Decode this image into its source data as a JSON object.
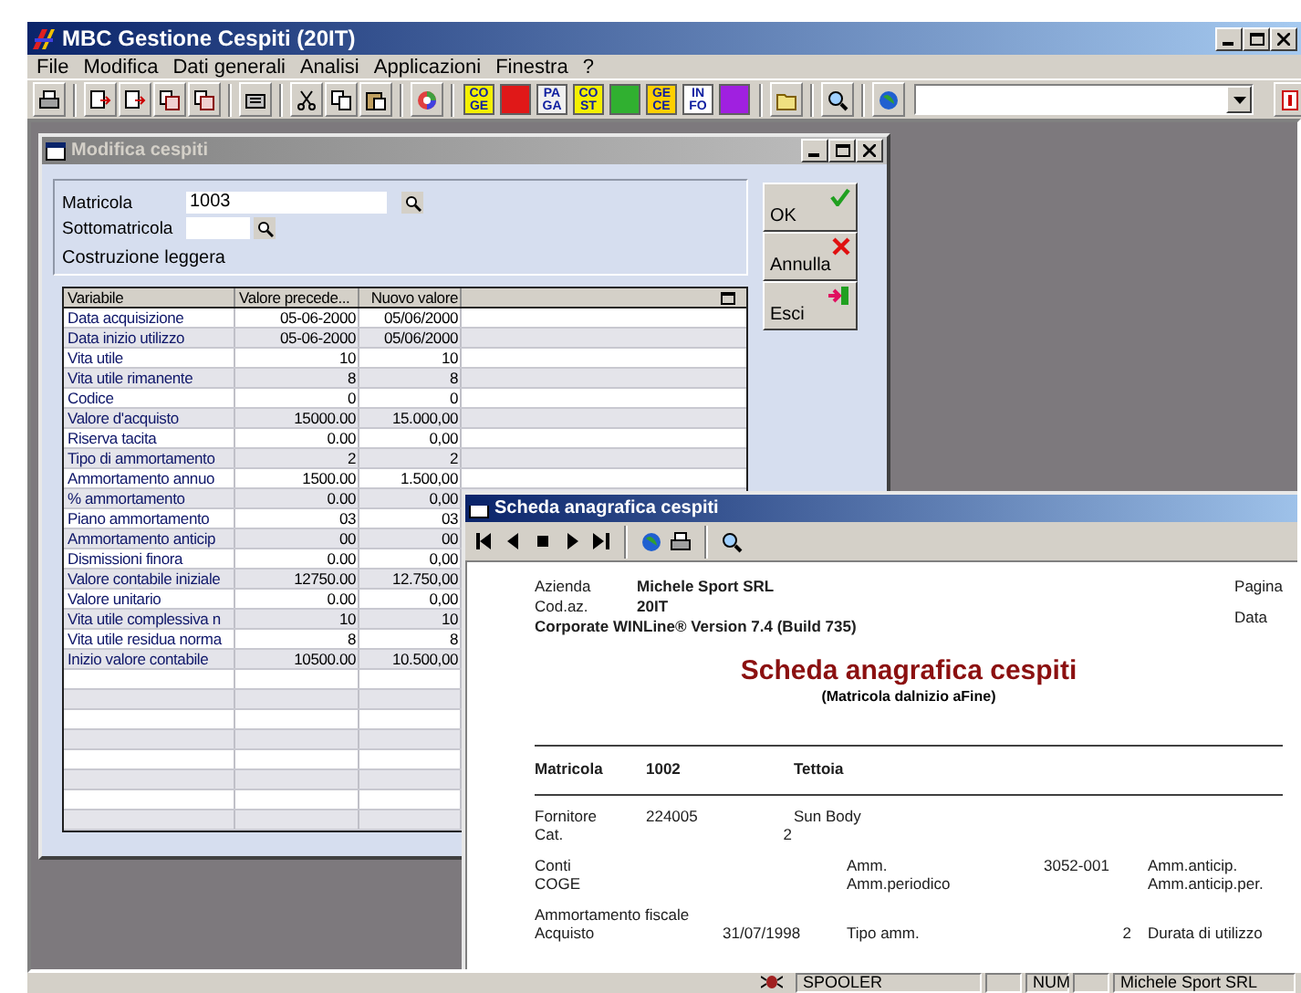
{
  "app": {
    "title": "MBC Gestione Cespiti (20IT)"
  },
  "menu": [
    "File",
    "Modifica",
    "Dati generali",
    "Analisi",
    "Applicazioni",
    "Finestra",
    "?"
  ],
  "toolbar": {
    "modules": [
      {
        "label": "CO GE",
        "color": "#f4f000",
        "kind": "text"
      },
      {
        "color": "#e01818",
        "kind": "plain"
      },
      {
        "label": "PA GA",
        "color": "#f0f0f0",
        "kind": "text"
      },
      {
        "label": "CO ST",
        "color": "#f4f000",
        "kind": "text"
      },
      {
        "color": "#30b030",
        "kind": "plain"
      },
      {
        "label": "GE CE",
        "color": "#ffd000",
        "kind": "text"
      },
      {
        "label": "IN FO",
        "color": "#ffffff",
        "kind": "text"
      },
      {
        "color": "#a020e0",
        "kind": "plain"
      }
    ]
  },
  "edit_window": {
    "title": "Modifica cespiti",
    "active": false,
    "fields": [
      {
        "label": "Matricola",
        "value": "1003",
        "kind": "wide"
      },
      {
        "label": "Sottomatricola",
        "kind": "narrow"
      }
    ],
    "description": "Costruzione leggera",
    "buttons": [
      {
        "label": "OK",
        "kind": "ok"
      },
      {
        "label": "Annulla",
        "kind": "cancel"
      },
      {
        "label": "Esci",
        "kind": "exit"
      }
    ],
    "table": {
      "columns": [
        "Variabile",
        "Valore precede...",
        "Nuovo valore"
      ],
      "rows": [
        [
          "Data acquisizione",
          "05-06-2000",
          "05/06/2000"
        ],
        [
          "Data inizio utilizzo",
          "05-06-2000",
          "05/06/2000"
        ],
        [
          "Vita utile",
          "10",
          "10"
        ],
        [
          "Vita utile rimanente",
          "8",
          "8"
        ],
        [
          "Codice",
          "0",
          "0"
        ],
        [
          "Valore d'acquisto",
          "15000.00",
          "15.000,00"
        ],
        [
          "Riserva tacita",
          "0.00",
          "0,00"
        ],
        [
          "Tipo di ammortamento",
          "2",
          "2"
        ],
        [
          "Ammortamento annuo",
          "1500.00",
          "1.500,00"
        ],
        [
          "% ammortamento",
          "0.00",
          "0,00"
        ],
        [
          "Piano ammortamento",
          "03",
          "03"
        ],
        [
          "Ammortamento anticip",
          "00",
          "00"
        ],
        [
          "Dismissioni finora",
          "0.00",
          "0,00"
        ],
        [
          "Valore contabile iniziale",
          "12750.00",
          "12.750,00"
        ],
        [
          "Valore unitario",
          "0.00",
          "0,00"
        ],
        [
          "Vita utile complessiva n",
          "10",
          "10"
        ],
        [
          "Vita utile residua norma",
          "8",
          "8"
        ],
        [
          "Inizio valore contabile",
          "10500.00",
          "10.500,00"
        ]
      ]
    }
  },
  "report_window": {
    "title": "Scheda anagrafica cespiti",
    "active": true,
    "report": {
      "company_label": "Azienda",
      "company": "Michele Sport SRL",
      "code_label": "Cod.az.",
      "code": "20IT",
      "version": "Corporate WINLine® Version 7.4 (Build 735)",
      "page_label": "Pagina",
      "date_label": "Data",
      "title": "Scheda anagrafica cespiti",
      "subtitle": "(Matricola dalnizio aFine)",
      "record": {
        "label": "Matricola",
        "code": "1002",
        "name": "Tettoia"
      },
      "supplier": {
        "label": "Fornitore",
        "code": "224005",
        "name": "Sun Body"
      },
      "category": {
        "label": "Cat.",
        "value": "2"
      },
      "accounts": {
        "label": "Conti",
        "sub_label": "COGE",
        "amm_label": "Amm.",
        "amm_value": "3052-001",
        "periodic_label": "Amm.periodico",
        "anticip_label": "Amm.anticip.",
        "anticip_per_label": "Amm.anticip.per."
      },
      "fiscal": {
        "label": "Ammortamento fiscale",
        "purchase_label": "Acquisto",
        "purchase_date": "31/07/1998",
        "type_label": "Tipo amm.",
        "type_value": "2",
        "duration_label": "Durata di utilizzo"
      }
    }
  },
  "status_bar": {
    "spooler": "SPOOLER",
    "num": "NUM",
    "company": "Michele Sport SRL"
  }
}
